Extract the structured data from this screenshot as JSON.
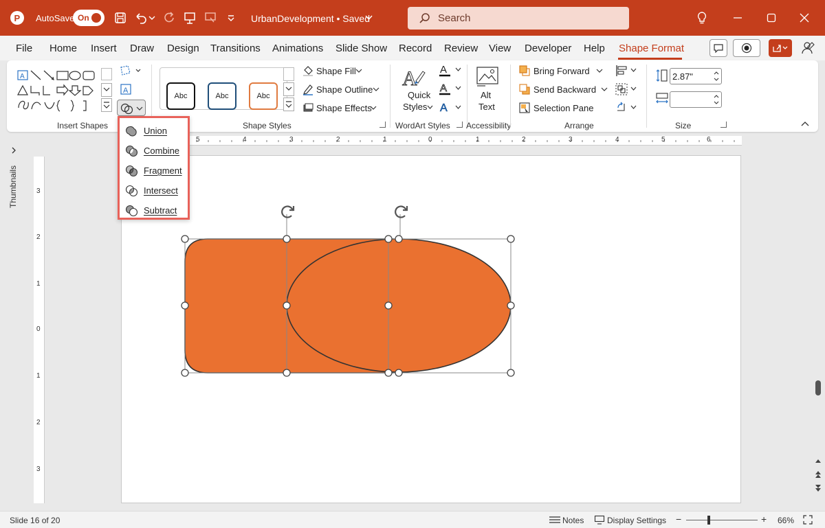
{
  "titlebar": {
    "autosave_label": "AutoSave",
    "autosave_state": "On",
    "document_title": "UrbanDevelopment • Saved",
    "search_placeholder": "Search",
    "brand_color": "#c43e1c"
  },
  "menu": {
    "items": [
      "File",
      "Home",
      "Insert",
      "Draw",
      "Design",
      "Transitions",
      "Animations",
      "Slide Show",
      "Record",
      "Review",
      "View",
      "Developer",
      "Help",
      "Shape Format"
    ],
    "active": "Shape Format"
  },
  "ribbon": {
    "insert_shapes": {
      "label": "Insert Shapes"
    },
    "shape_styles": {
      "label": "Shape Styles",
      "style_samples": [
        "Abc",
        "Abc",
        "Abc"
      ],
      "shape_fill": "Shape Fill",
      "shape_outline": "Shape Outline",
      "shape_effects": "Shape Effects"
    },
    "wordart": {
      "label": "WordArt Styles",
      "quick_styles_1": "Quick",
      "quick_styles_2": "Styles"
    },
    "accessibility": {
      "label": "Accessibility",
      "alt_text_1": "Alt",
      "alt_text_2": "Text"
    },
    "arrange": {
      "label": "Arrange",
      "bring_forward": "Bring Forward",
      "send_backward": "Send Backward",
      "selection_pane": "Selection Pane"
    },
    "size": {
      "label": "Size",
      "height_value": "2.87\"",
      "width_value": ""
    }
  },
  "merge_shapes_menu": {
    "items": [
      "Union",
      "Combine",
      "Fragment",
      "Intersect",
      "Subtract"
    ]
  },
  "workspace": {
    "thumbnails_label": "Thumbnails",
    "ruler_h_ticks": [
      "5",
      "4",
      "3",
      "2",
      "1",
      "0",
      "1",
      "2",
      "3",
      "4",
      "5",
      "6"
    ],
    "ruler_v_ticks": [
      "3",
      "2",
      "1",
      "0",
      "1",
      "2",
      "3"
    ],
    "shape_fill_color": "#ea7130"
  },
  "statusbar": {
    "slide_info": "Slide 16 of 20",
    "notes": "Notes",
    "display_settings": "Display Settings",
    "zoom": "66%"
  }
}
